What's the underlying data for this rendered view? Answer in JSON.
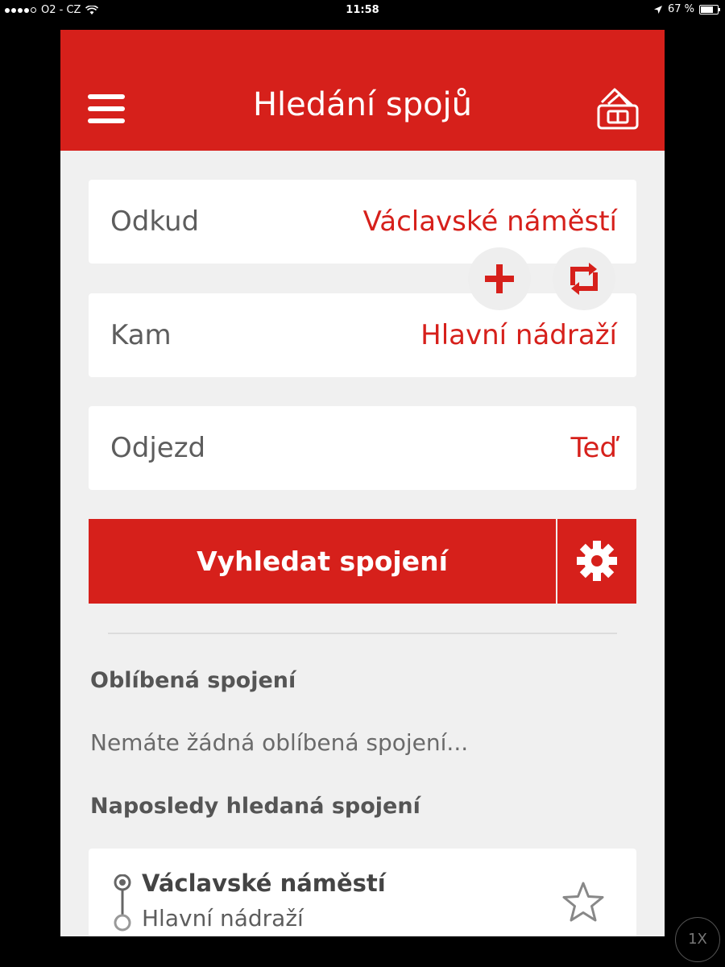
{
  "status_bar": {
    "carrier": "O2 - CZ",
    "time": "11:58",
    "battery": "67 %"
  },
  "header": {
    "title": "Hledání spojů",
    "menu_icon": "hamburger-menu-icon",
    "ticket_icon": "ticket-wallet-icon"
  },
  "form": {
    "from": {
      "label": "Odkud",
      "value": "Václavské náměstí"
    },
    "to": {
      "label": "Kam",
      "value": "Hlavní nádraží"
    },
    "departure": {
      "label": "Odjezd",
      "value": "Teď"
    },
    "add_icon": "plus-icon",
    "swap_icon": "swap-icon"
  },
  "search": {
    "button_label": "Vyhledat spojení",
    "settings_icon": "gear-icon"
  },
  "favorites": {
    "heading": "Oblíbená spojení",
    "empty_text": "Nemáte žádná oblíbená spojení..."
  },
  "recent": {
    "heading": "Naposledy hledaná spojení",
    "items": [
      {
        "from": "Václavské náměstí",
        "to": "Hlavní nádraží",
        "star_icon": "star-outline-icon"
      }
    ]
  },
  "zoom_badge": "1X",
  "colors": {
    "accent": "#d6201b",
    "background": "#f0f0f0"
  }
}
